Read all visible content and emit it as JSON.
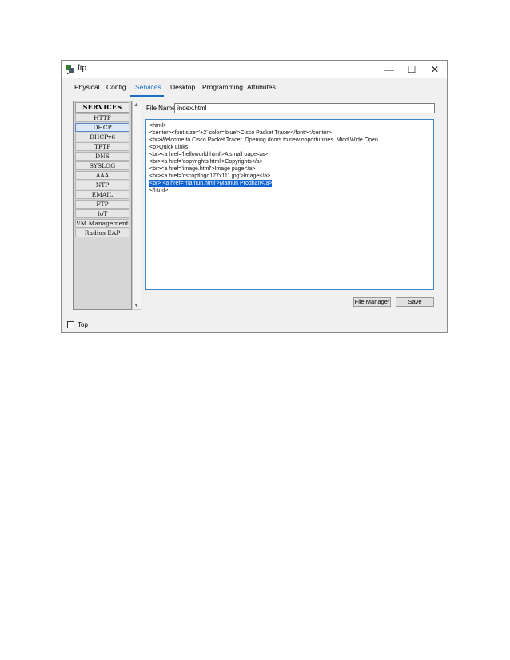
{
  "window": {
    "title": "ftp",
    "minimize": "—",
    "maximize": "☐",
    "close": "✕"
  },
  "tabs": [
    {
      "label": "Physical"
    },
    {
      "label": "Config"
    },
    {
      "label": "Services",
      "active": true
    },
    {
      "label": "Desktop"
    },
    {
      "label": "Programming"
    },
    {
      "label": "Attributes"
    }
  ],
  "services": {
    "header": "SERVICES",
    "items": [
      "HTTP",
      "DHCP",
      "DHCPv6",
      "TFTP",
      "DNS",
      "SYSLOG",
      "AAA",
      "NTP",
      "EMAIL",
      "FTP",
      "IoT",
      "VM Management",
      "Radius EAP"
    ],
    "selected": "DHCP"
  },
  "file": {
    "label": "File Name:",
    "value": "index.html"
  },
  "editor": {
    "lines": [
      "<html>",
      "<center><font size='+2' color='blue'>Cisco Packet Tracer</font></center>",
      "<hr>Welcome to Cisco Packet Tracer. Opening doors to new opportunities. Mind Wide Open.",
      "<p>Quick Links:",
      "<br><a href='helloworld.html'>A small page</a>",
      "<br><a href='copyrights.html'>Copyrights</a>",
      "<br><a href='image.html'>Image page</a>",
      "<br><a href='cscoptlogo177x111.jpg'>Image</a>",
      "<br> <a href='mamun.html'>Mamun Prodhan</a>",
      "</html>"
    ],
    "highlighted_line": 8
  },
  "buttons": {
    "file_manager": "File Manager",
    "save": "Save"
  },
  "footer": {
    "top_label": "Top"
  },
  "colors": {
    "accent": "#1a6fc4",
    "selection": "#0f62d1"
  }
}
